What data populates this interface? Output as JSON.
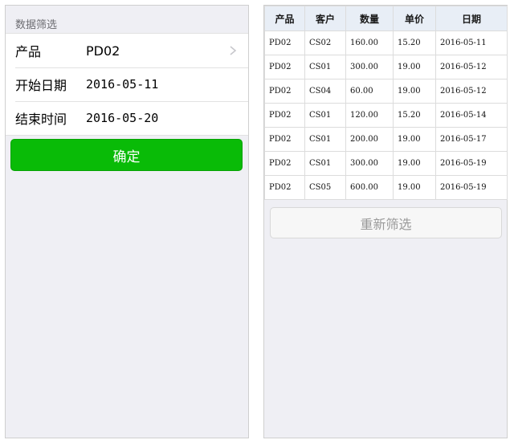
{
  "filter": {
    "section_title": "数据筛选",
    "rows": [
      {
        "label": "产品",
        "value": "PD02"
      },
      {
        "label": "开始日期",
        "value": "2016-05-11"
      },
      {
        "label": "结束时间",
        "value": "2016-05-20"
      }
    ],
    "confirm_label": "确定"
  },
  "results": {
    "columns": [
      "产品",
      "客户",
      "数量",
      "单价",
      "日期"
    ],
    "rows": [
      [
        "PD02",
        "CS02",
        "160.00",
        "15.20",
        "2016-05-11"
      ],
      [
        "PD02",
        "CS01",
        "300.00",
        "19.00",
        "2016-05-12"
      ],
      [
        "PD02",
        "CS04",
        "60.00",
        "19.00",
        "2016-05-12"
      ],
      [
        "PD02",
        "CS01",
        "120.00",
        "15.20",
        "2016-05-14"
      ],
      [
        "PD02",
        "CS01",
        "200.00",
        "19.00",
        "2016-05-17"
      ],
      [
        "PD02",
        "CS01",
        "300.00",
        "19.00",
        "2016-05-19"
      ],
      [
        "PD02",
        "CS05",
        "600.00",
        "19.00",
        "2016-05-19"
      ]
    ],
    "reset_label": "重新筛选"
  },
  "colors": {
    "confirm_green": "#09bb07",
    "header_bg": "#e8eef6",
    "page_bg": "#efeff4"
  },
  "icons": {
    "product_chevron": "chevron-right-icon"
  }
}
